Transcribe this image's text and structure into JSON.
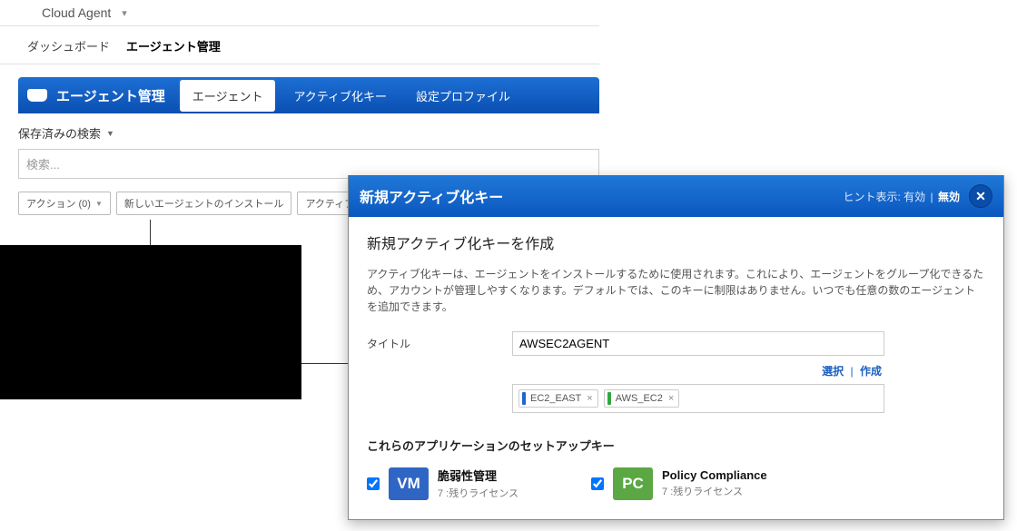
{
  "appSelector": {
    "label": "Cloud Agent"
  },
  "navTabs": {
    "dashboard": "ダッシュボード",
    "agentMgmt": "エージェント管理"
  },
  "mgmtBar": {
    "title": "エージェント管理",
    "tabAgent": "エージェント",
    "tabActKey": "アクティブ化キー",
    "tabProfile": "設定プロファイル"
  },
  "savedSearch": "保存済みの検索",
  "searchPlaceholder": "検索...",
  "actionRow": {
    "actions": "アクション (0)",
    "installNew": "新しいエージェントのインストール",
    "actJob": "アクティブ化ジョブ"
  },
  "modal": {
    "title": "新規アクティブ化キー",
    "hintLabel": "ヒント表示:",
    "hintOn": "有効",
    "hintOff": "無効",
    "heading": "新規アクティブ化キーを作成",
    "description": "アクティブ化キーは、エージェントをインストールするために使用されます。これにより、エージェントをグループ化できるため、アカウントが管理しやすくなります。デフォルトでは、このキーに制限はありません。いつでも任意の数のエージェントを追加できます。",
    "titleLabel": "タイトル",
    "titleValue": "AWSEC2AGENT",
    "selectLink": "選択",
    "createLink": "作成",
    "tags": [
      {
        "label": "EC2_EAST",
        "color": "blue"
      },
      {
        "label": "AWS_EC2",
        "color": "green"
      }
    ],
    "appsHeading": "これらのアプリケーションのセットアップキー",
    "apps": {
      "vm": {
        "code": "VM",
        "name": "脆弱性管理",
        "sub": "7 :残りライセンス"
      },
      "pc": {
        "code": "PC",
        "name": "Policy Compliance",
        "sub": "7 :残りライセンス"
      }
    }
  }
}
